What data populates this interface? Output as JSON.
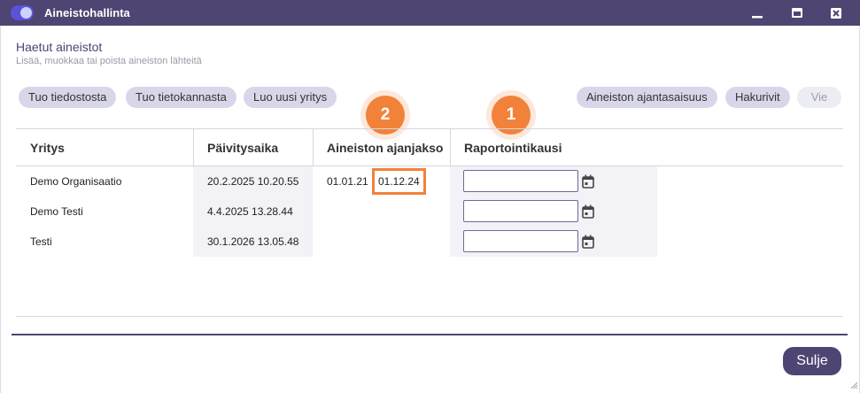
{
  "window": {
    "title": "Aineistohallinta",
    "accent": "#4e4572",
    "highlight": "#f2823a"
  },
  "header": {
    "title": "Haetut aineistot",
    "subtitle": "Lisää, muokkaa tai poista aineiston lähteitä"
  },
  "toolbar": {
    "left_buttons": [
      "Tuo tiedostosta",
      "Tuo tietokannasta",
      "Luo uusi yritys"
    ],
    "right_buttons": [
      "Aineiston ajantasaisuus",
      "Hakurivit",
      "Vie"
    ]
  },
  "annotations": {
    "badge_1": "1",
    "badge_2": "2"
  },
  "table": {
    "columns": [
      "Yritys",
      "Päivitysaika",
      "Aineiston ajanjakso",
      "Raportointikausi"
    ],
    "rows": [
      {
        "company": "Demo Organisaatio",
        "updated": "20.2.2025 10.20.55",
        "period_start": "01.01.21",
        "period_end": "01.12.24",
        "reporting": ""
      },
      {
        "company": "Demo Testi",
        "updated": "4.4.2025 13.28.44",
        "period_start": "",
        "period_end": "",
        "reporting": ""
      },
      {
        "company": "Testi",
        "updated": "30.1.2026 13.05.48",
        "period_start": "",
        "period_end": "",
        "reporting": ""
      }
    ]
  },
  "footer": {
    "close_label": "Sulje"
  }
}
